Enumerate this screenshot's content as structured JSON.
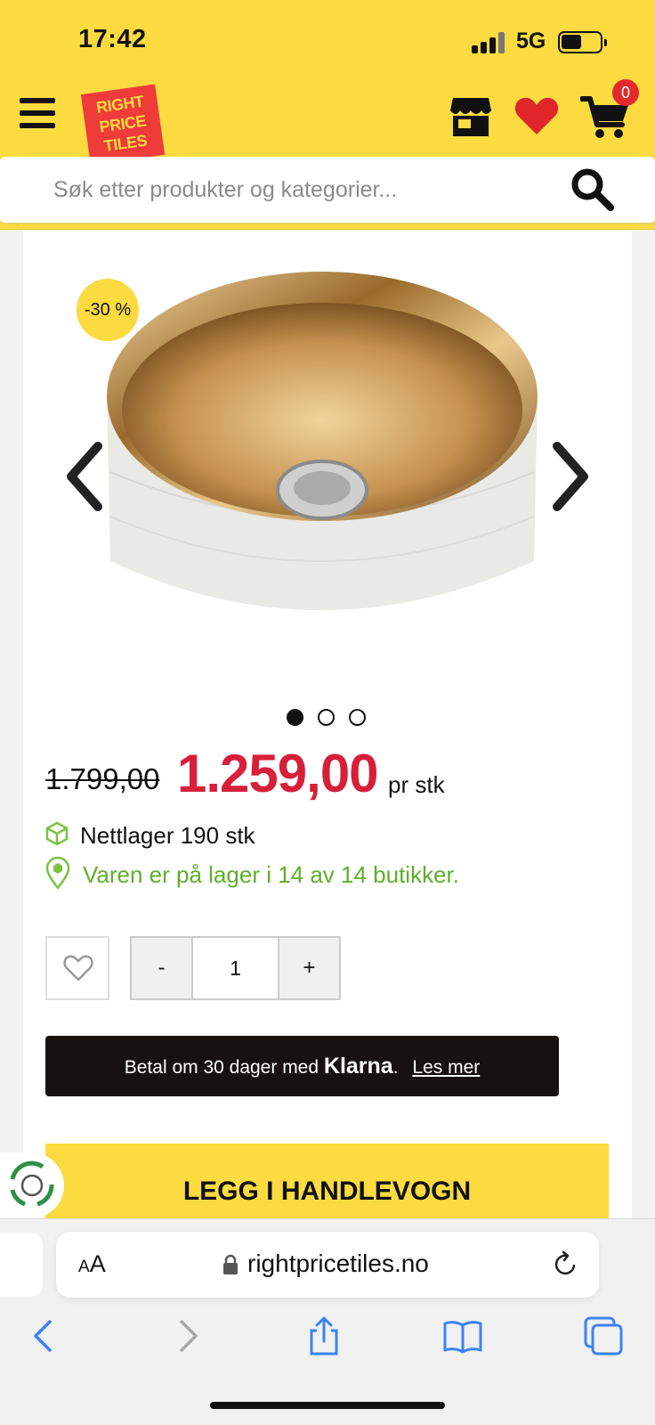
{
  "status_bar": {
    "time": "17:42",
    "network": "5G"
  },
  "header": {
    "logo_lines": [
      "RIGHT",
      "PRICE",
      "TILES"
    ],
    "cart_count": "0",
    "search_placeholder": "Søk etter produkter og kategorier..."
  },
  "product": {
    "discount_badge": "-30 %",
    "old_price": "1.799,00",
    "new_price": "1.259,00",
    "unit": "pr stk",
    "stock_online": "Nettlager 190 stk",
    "stock_stores": "Varen er på lager i 14 av 14 butikker.",
    "quantity": "1",
    "qty_minus": "-",
    "qty_plus": "+",
    "image_count": 3,
    "active_image": 1
  },
  "klarna": {
    "prefix": "Betal om 30 dager med",
    "brand": "Klarna",
    "suffix": ".",
    "link": "Les mer"
  },
  "add_to_cart_label": "LEGG I HANDLEVOGN",
  "browser": {
    "aa_small": "A",
    "aa_large": "A",
    "url": "rightpricetiles.no"
  },
  "colors": {
    "brand_yellow": "#fbdb3f",
    "sale_red": "#d71f3a",
    "stock_green": "#5fae2b",
    "klarna_bg": "#17120f"
  }
}
